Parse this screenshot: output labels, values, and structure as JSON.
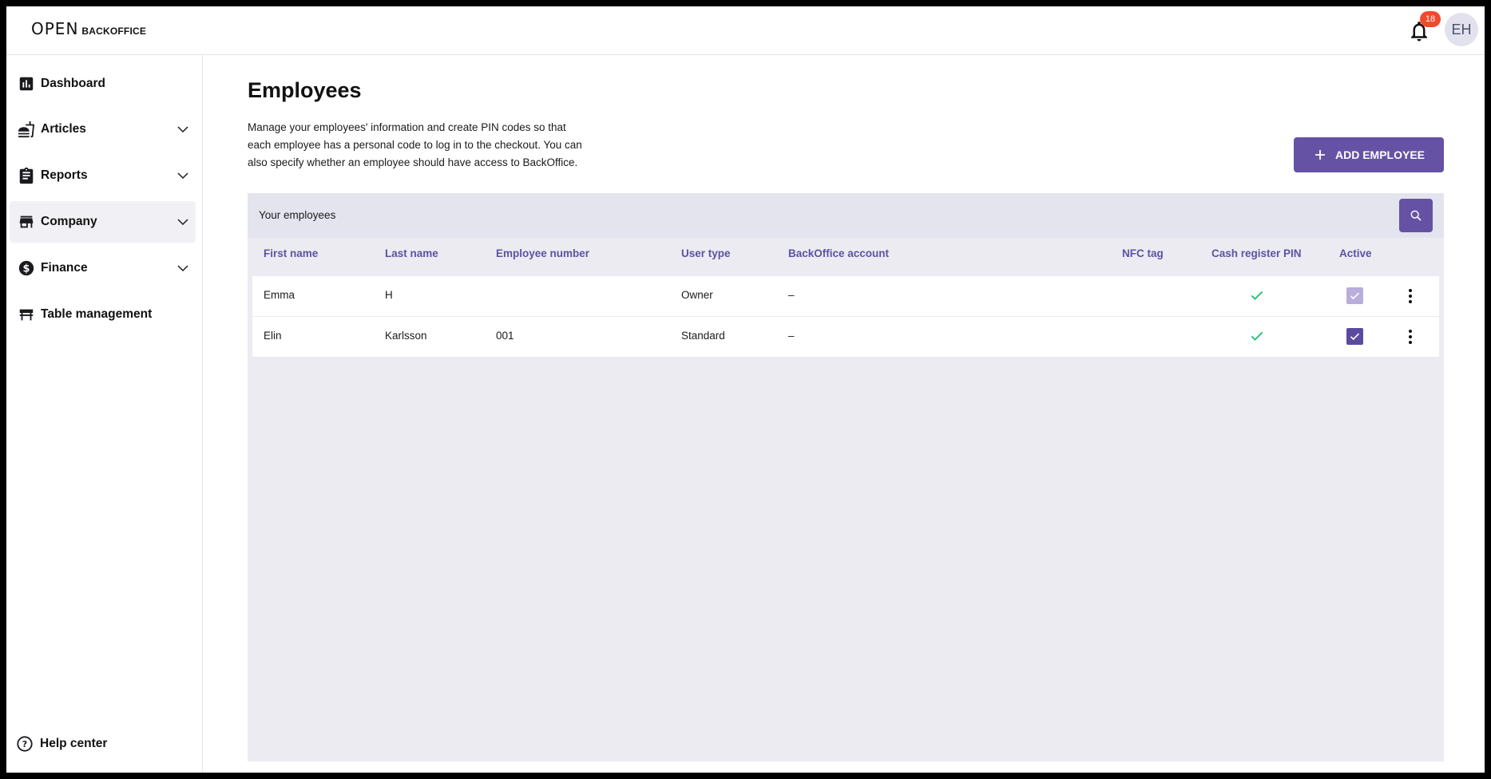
{
  "header": {
    "logo_mark": "OPEN",
    "logo_text": "BACKOFFICE",
    "notification_count": "18",
    "avatar_initials": "EH"
  },
  "sidebar": {
    "items": [
      {
        "label": "Dashboard",
        "icon": "bar-chart-icon",
        "has_chevron": false,
        "active": false
      },
      {
        "label": "Articles",
        "icon": "food-icon",
        "has_chevron": true,
        "active": false
      },
      {
        "label": "Reports",
        "icon": "clipboard-icon",
        "has_chevron": true,
        "active": false
      },
      {
        "label": "Company",
        "icon": "store-icon",
        "has_chevron": true,
        "active": true
      },
      {
        "label": "Finance",
        "icon": "dollar-icon",
        "has_chevron": true,
        "active": false
      },
      {
        "label": "Table management",
        "icon": "table-icon",
        "has_chevron": false,
        "active": false
      }
    ],
    "help_label": "Help center"
  },
  "main": {
    "title": "Employees",
    "description": "Manage your employees' information and create PIN codes so that each employee has a personal code to log in to the checkout. You can also specify whether an employee should have access to BackOffice.",
    "add_button_label": "ADD EMPLOYEE",
    "panel_title": "Your employees",
    "columns": [
      "First name",
      "Last name",
      "Employee number",
      "User type",
      "BackOffice account",
      "NFC tag",
      "Cash register PIN",
      "Active"
    ],
    "rows": [
      {
        "first_name": "Emma",
        "last_name": "H",
        "employee_number": "",
        "user_type": "Owner",
        "backoffice_account": "–",
        "nfc_tag": "",
        "pin_set": true,
        "active": true,
        "active_disabled": true
      },
      {
        "first_name": "Elin",
        "last_name": "Karlsson",
        "employee_number": "001",
        "user_type": "Standard",
        "backoffice_account": "–",
        "nfc_tag": "",
        "pin_set": true,
        "active": true,
        "active_disabled": false
      }
    ]
  },
  "colors": {
    "accent": "#6652a5",
    "header_text": "#5c52a3",
    "check_green": "#22c07a",
    "badge": "#f04a2b"
  }
}
